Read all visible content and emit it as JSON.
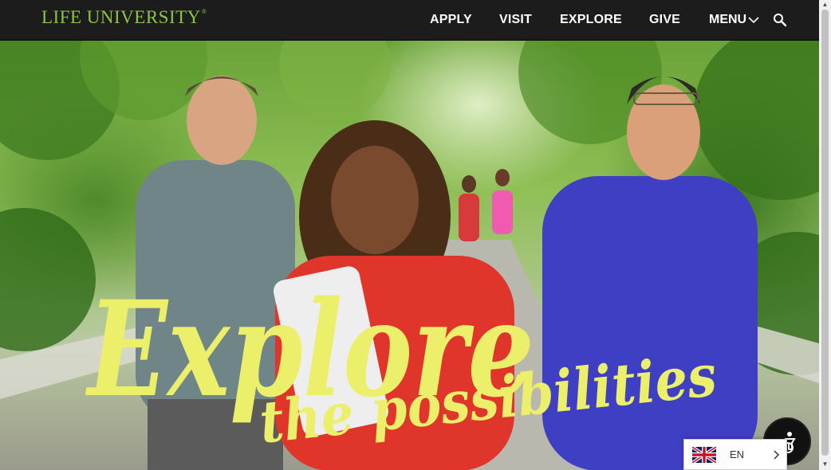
{
  "header": {
    "logo_text": "LIFE UNIVERSITY",
    "logo_mark": "®",
    "brand_color": "#8cc63f",
    "nav": {
      "apply": "APPLY",
      "visit": "VISIT",
      "explore": "EXPLORE",
      "give": "GIVE",
      "menu": "MENU"
    },
    "icons": {
      "menu": "chevron-down-icon",
      "search": "search-icon"
    }
  },
  "hero": {
    "headline_line1": "Explore",
    "headline_line2": "the possibilities",
    "headline_color": "#ecef6a"
  },
  "widgets": {
    "accessibility": {
      "icon": "accessibility-icon"
    },
    "language": {
      "code": "EN",
      "flag": "uk-flag-icon"
    }
  }
}
